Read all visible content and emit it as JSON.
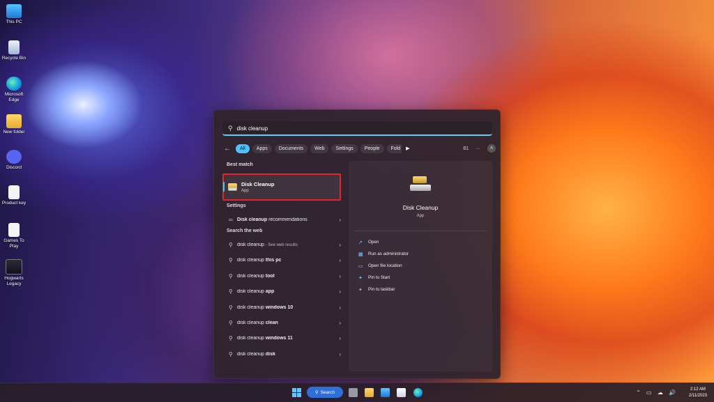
{
  "desktop": {
    "icons": [
      {
        "label": "This PC"
      },
      {
        "label": "Recycle Bin"
      },
      {
        "label": "Microsoft Edge"
      },
      {
        "label": "New folder"
      },
      {
        "label": "Discord"
      },
      {
        "label": "Product key"
      },
      {
        "label": "Games To Play"
      },
      {
        "label": "Hogwarts Legacy"
      }
    ]
  },
  "search": {
    "query": "disk cleanup",
    "filters": [
      "All",
      "Apps",
      "Documents",
      "Web",
      "Settings",
      "People",
      "Fold"
    ],
    "active_filter": "All",
    "count": "81",
    "more": "···",
    "avatar": "A"
  },
  "best_match": {
    "heading": "Best match",
    "title": "Disk Cleanup",
    "subtitle": "App"
  },
  "settings": {
    "heading": "Settings",
    "item_bold": "Disk cleanup",
    "item_rest": " recommendations"
  },
  "web": {
    "heading": "Search the web",
    "first": {
      "text": "disk cleanup",
      "muted": " - See web results"
    },
    "items": [
      {
        "base": "disk cleanup ",
        "bold": "this pc"
      },
      {
        "base": "disk cleanup ",
        "bold": "tool"
      },
      {
        "base": "disk cleanup ",
        "bold": "app"
      },
      {
        "base": "disk cleanup ",
        "bold": "windows 10"
      },
      {
        "base": "disk cleanup ",
        "bold": "clean"
      },
      {
        "base": "disk cleanup ",
        "bold": "windows 11"
      },
      {
        "base": "disk cleanup ",
        "bold": "disk"
      }
    ]
  },
  "detail": {
    "title": "Disk Cleanup",
    "subtitle": "App",
    "actions": [
      "Open",
      "Run as administrator",
      "Open file location",
      "Pin to Start",
      "Pin to taskbar"
    ]
  },
  "taskbar": {
    "search_label": "Search",
    "time": "2:12 AM",
    "date": "2/11/2023"
  },
  "colors": {
    "accent": "#4cc2ff",
    "highlight_border": "#e5252e",
    "taskbar_search": "#2f6fd8"
  }
}
